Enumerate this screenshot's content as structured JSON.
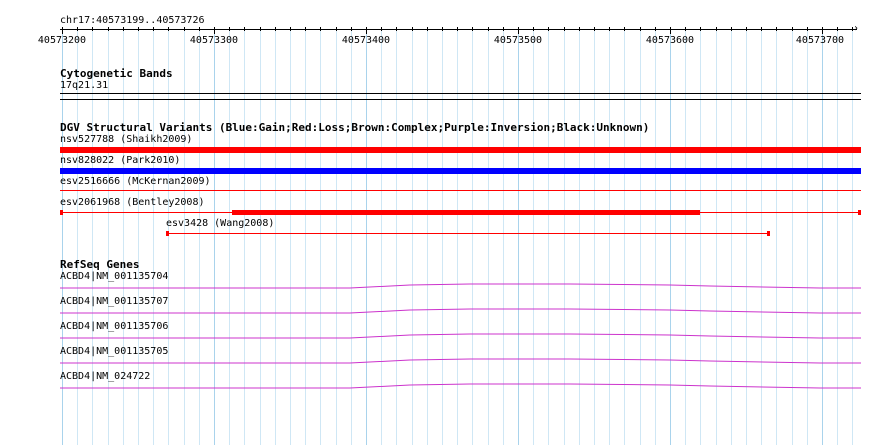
{
  "ruler": {
    "region_label": "chr17:40573199..40573726",
    "start": 40573199,
    "end": 40573726,
    "ticks": [
      "40573200",
      "40573300",
      "40573400",
      "40573500",
      "40573600",
      "40573700"
    ]
  },
  "colors": {
    "grid_minor": "#cfe7f5",
    "grid_major": "#a9d3ec",
    "loss": "#ff0000",
    "gain": "#0000ff",
    "gene": "#cc33cc"
  },
  "tracks": {
    "cytoband": {
      "title": "Cytogenetic Bands",
      "band": "17q21.31"
    },
    "dgv": {
      "title": "DGV Structural Variants (Blue:Gain;Red:Loss;Brown:Complex;Purple:Inversion;Black:Unknown)",
      "features": [
        {
          "label": "nsv527788 (Shaikh2009)",
          "type": "Loss"
        },
        {
          "label": "nsv828022 (Park2010)",
          "type": "Gain"
        },
        {
          "label": "esv2516666 (McKernan2009)",
          "type": "Loss"
        },
        {
          "label": "esv2061968 (Bentley2008)",
          "type": "Loss"
        },
        {
          "label": "esv3428 (Wang2008)",
          "type": "Loss"
        }
      ]
    },
    "refseq": {
      "title": "RefSeq Genes",
      "genes": [
        {
          "label": "ACBD4|NM_001135704"
        },
        {
          "label": "ACBD4|NM_001135707"
        },
        {
          "label": "ACBD4|NM_001135706"
        },
        {
          "label": "ACBD4|NM_001135705"
        },
        {
          "label": "ACBD4|NM_024722"
        }
      ]
    }
  }
}
